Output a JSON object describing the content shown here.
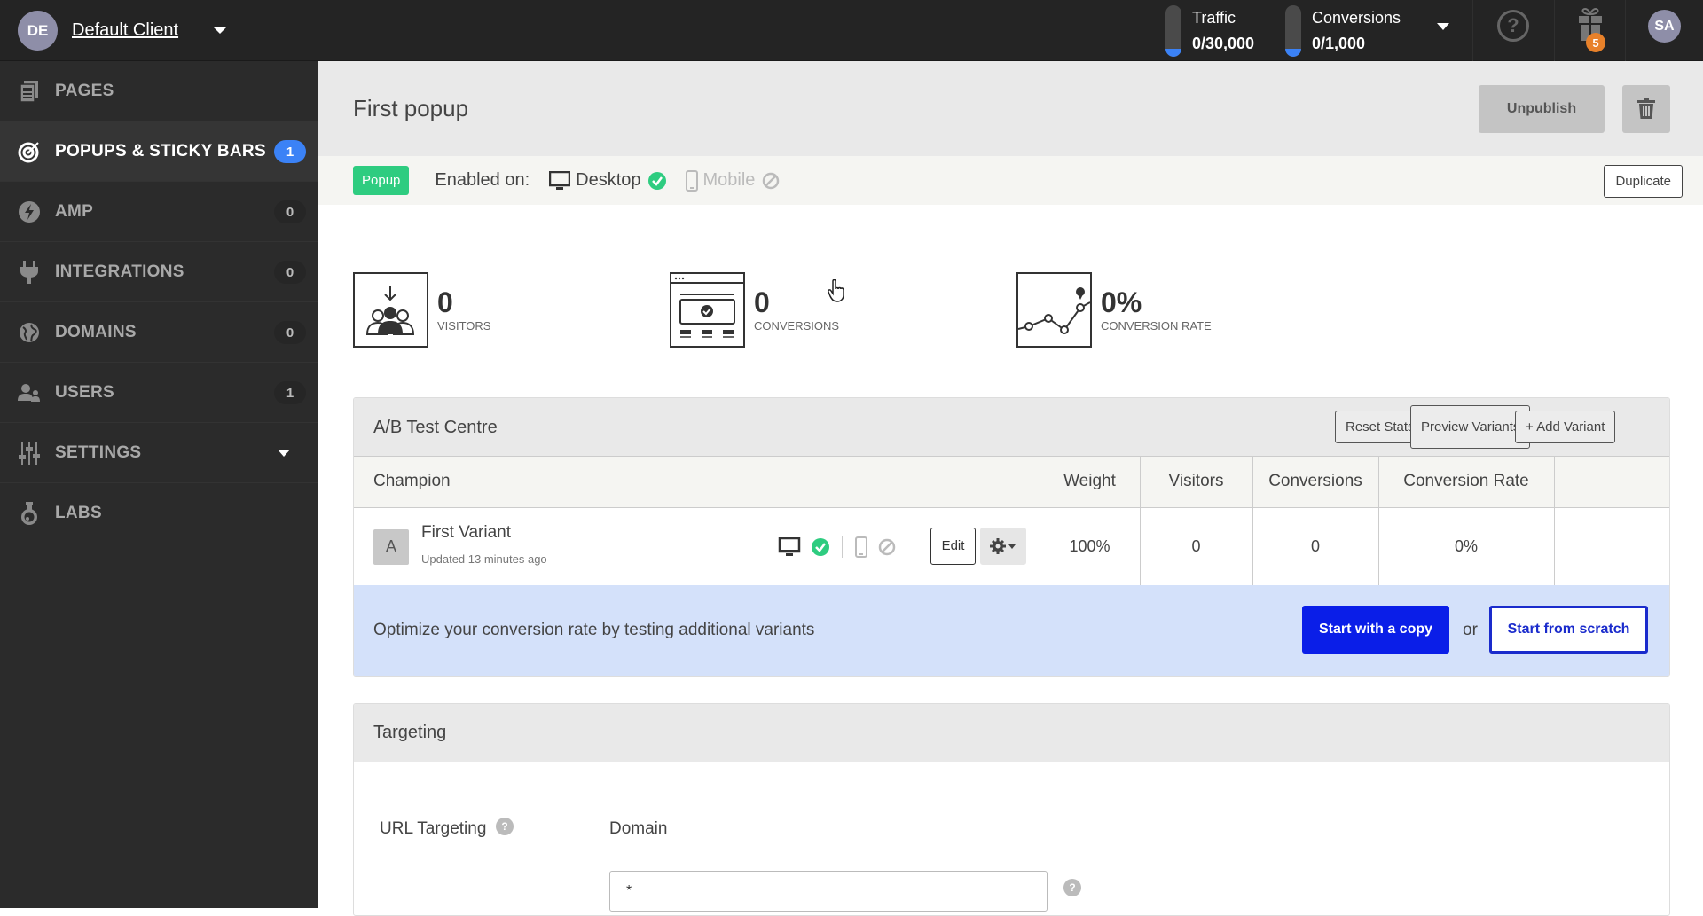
{
  "topbar": {
    "client_initials": "DE",
    "client_name": "Default Client",
    "traffic": {
      "label": "Traffic",
      "value": "0/30,000",
      "usage_fraction": 0
    },
    "conversions": {
      "label": "Conversions",
      "value": "0/1,000",
      "usage_fraction": 0
    },
    "help_icon": "?",
    "gift_badge_count": "5",
    "user_initials": "SA"
  },
  "sidebar": {
    "items": [
      {
        "label": "PAGES",
        "icon": "pages-icon",
        "badge": null
      },
      {
        "label": "POPUPS & STICKY BARS",
        "icon": "target-icon",
        "badge": "1",
        "active": true
      },
      {
        "label": "AMP",
        "icon": "lightning-icon",
        "badge": "0"
      },
      {
        "label": "INTEGRATIONS",
        "icon": "plug-icon",
        "badge": "0"
      },
      {
        "label": "DOMAINS",
        "icon": "globe-icon",
        "badge": "0"
      },
      {
        "label": "USERS",
        "icon": "users-icon",
        "badge": "1"
      },
      {
        "label": "SETTINGS",
        "icon": "sliders-icon",
        "badge": null
      },
      {
        "label": "LABS",
        "icon": "flask-icon",
        "badge": null
      }
    ]
  },
  "page": {
    "title": "First popup",
    "unpublish_label": "Unpublish",
    "type_badge": "Popup",
    "enabled_on_label": "Enabled on:",
    "desktop_label": "Desktop",
    "mobile_label": "Mobile",
    "duplicate_label": "Duplicate"
  },
  "stats": {
    "visitors": {
      "value": "0",
      "label": "VISITORS"
    },
    "conversions": {
      "value": "0",
      "label": "CONVERSIONS"
    },
    "conversion_rate": {
      "value": "0%",
      "label": "CONVERSION RATE"
    }
  },
  "ab_test": {
    "title": "A/B Test Centre",
    "reset_label": "Reset Stats",
    "preview_label": "Preview Variants",
    "add_label": "+ Add Variant",
    "columns": [
      "Champion",
      "Weight",
      "Visitors",
      "Conversions",
      "Conversion Rate",
      ""
    ],
    "variants": [
      {
        "letter": "A",
        "name": "First Variant",
        "updated": "Updated 13 minutes ago",
        "edit_label": "Edit",
        "weight": "100%",
        "visitors": "0",
        "conversions": "0",
        "conversion_rate": "0%"
      }
    ],
    "optimize_text": "Optimize your conversion rate by testing additional variants",
    "copy_label": "Start with a copy",
    "or_text": "or",
    "scratch_label": "Start from scratch"
  },
  "targeting": {
    "title": "Targeting",
    "url_label": "URL Targeting",
    "domain_label": "Domain",
    "domain_value": "*",
    "help_glyph": "?"
  },
  "colors": {
    "accent_blue": "#0a1ee8",
    "badge_green": "#2ecc80",
    "badge_blue": "#3b82f6",
    "gift_orange": "#e8812a"
  }
}
